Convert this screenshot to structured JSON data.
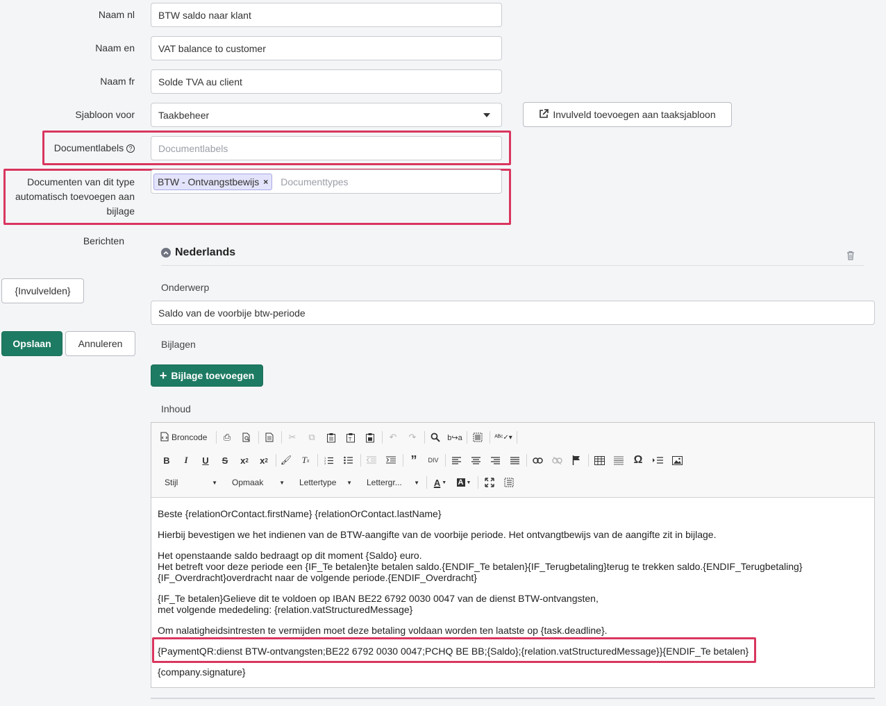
{
  "form": {
    "naam_nl_label": "Naam nl",
    "naam_nl_value": "BTW saldo naar klant",
    "naam_en_label": "Naam en",
    "naam_en_value": "VAT balance to customer",
    "naam_fr_label": "Naam fr",
    "naam_fr_value": "Solde TVA au client",
    "sjabloon_label": "Sjabloon voor",
    "sjabloon_value": "Taakbeheer",
    "invulveld_button": "Invulveld toevoegen aan taaksjabloon",
    "documentlabels_label": "Documentlabels",
    "documentlabels_placeholder": "Documentlabels",
    "doctypes_label_line1": "Documenten van dit type",
    "doctypes_label_line2": "automatisch toevoegen aan",
    "doctypes_label_line3": "bijlage",
    "doctype_tag": "BTW - Ontvangstbewijs",
    "doctypes_placeholder": "Documenttypes",
    "berichten_label": "Berichten"
  },
  "sidebar": {
    "invulvelden_button": "{Invulvelden}",
    "save_button": "Opslaan",
    "cancel_button": "Annuleren"
  },
  "message": {
    "language": "Nederlands",
    "subject_label": "Onderwerp",
    "subject_value": "Saldo van de voorbije btw-periode",
    "attachments_label": "Bijlagen",
    "add_attachment_button": "Bijlage toevoegen",
    "content_label": "Inhoud"
  },
  "editor": {
    "source_button": "Broncode",
    "style_combo": "Stijl",
    "format_combo": "Opmaak",
    "font_combo": "Lettertype",
    "size_combo": "Lettergr...",
    "body": [
      "Beste {relationOrContact.firstName} {relationOrContact.lastName}",
      "Hierbij bevestigen we het indienen van de BTW-aangifte van de voorbije periode. Het ontvangtbewijs van de aangifte zit in bijlage.",
      "Het openstaande saldo bedraagt op dit moment {Saldo} euro.",
      "Het betreft voor deze periode een {IF_Te betalen}te betalen saldo.{ENDIF_Te betalen}{IF_Terugbetaling}terug te trekken saldo.{ENDIF_Terugbetaling}",
      "{IF_Overdracht}overdracht naar de volgende periode.{ENDIF_Overdracht}",
      "{IF_Te betalen}Gelieve dit te voldoen op IBAN BE22 6792 0030 0047 van de dienst BTW-ontvangsten,",
      "met volgende mededeling: {relation.vatStructuredMessage}",
      "Om nalatigheidsintresten te vermijden moet deze betaling voldaan worden ten laatste op {task.deadline}.",
      "{PaymentQR:dienst BTW-ontvangsten;BE22 6792 0030 0047;PCHQ BE BB;{Saldo};{relation.vatStructuredMessage}}{ENDIF_Te betalen}",
      "{company.signature}"
    ]
  },
  "colors": {
    "highlight": "#d9365f",
    "primary_green": "#1e7b63",
    "tag_bg": "#e3e3fb"
  }
}
